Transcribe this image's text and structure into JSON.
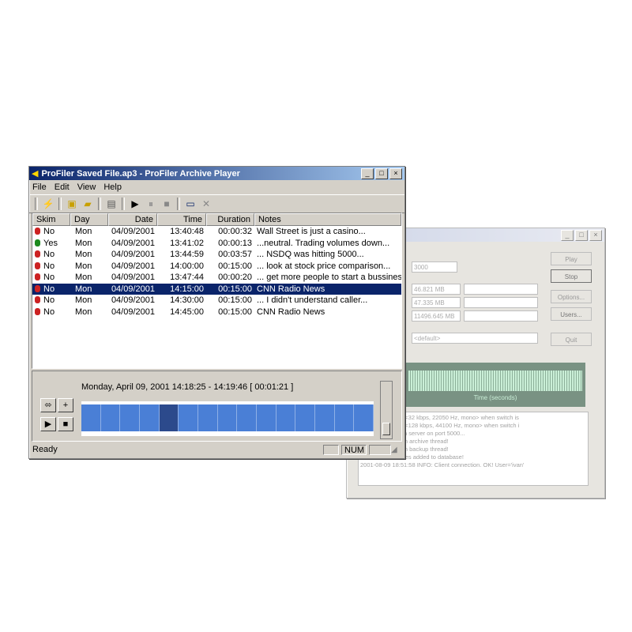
{
  "front_window": {
    "title": "ProFiler Saved File.ap3 - ProFiler Archive Player",
    "menu": [
      "File",
      "Edit",
      "View",
      "Help"
    ],
    "columns": [
      "Skim",
      "Day",
      "Date",
      "Time",
      "Duration",
      "Notes"
    ],
    "rows": [
      {
        "skim": "No",
        "mic_color": "#cc2222",
        "day": "Mon",
        "date": "04/09/2001",
        "time": "13:40:48",
        "duration": "00:00:32",
        "notes": "Wall Street is just a casino..."
      },
      {
        "skim": "Yes",
        "mic_color": "#1e8a1e",
        "day": "Mon",
        "date": "04/09/2001",
        "time": "13:41:02",
        "duration": "00:00:13",
        "notes": "...neutral.  Trading volumes down..."
      },
      {
        "skim": "No",
        "mic_color": "#cc2222",
        "day": "Mon",
        "date": "04/09/2001",
        "time": "13:44:59",
        "duration": "00:03:57",
        "notes": "... NSDQ was hitting 5000..."
      },
      {
        "skim": "No",
        "mic_color": "#cc2222",
        "day": "Mon",
        "date": "04/09/2001",
        "time": "14:00:00",
        "duration": "00:15:00",
        "notes": "... look at stock price comparison..."
      },
      {
        "skim": "No",
        "mic_color": "#cc2222",
        "day": "Mon",
        "date": "04/09/2001",
        "time": "13:47:44",
        "duration": "00:00:20",
        "notes": "... get more people to start a bussiness"
      },
      {
        "skim": "No",
        "mic_color": "#cc2222",
        "day": "Mon",
        "date": "04/09/2001",
        "time": "14:15:00",
        "duration": "00:15:00",
        "notes": "CNN Radio News",
        "selected": true
      },
      {
        "skim": "No",
        "mic_color": "#cc2222",
        "day": "Mon",
        "date": "04/09/2001",
        "time": "14:30:00",
        "duration": "00:15:00",
        "notes": "... I didn't understand caller..."
      },
      {
        "skim": "No",
        "mic_color": "#cc2222",
        "day": "Mon",
        "date": "04/09/2001",
        "time": "14:45:00",
        "duration": "00:15:00",
        "notes": "CNN Radio News"
      }
    ],
    "timeline_label": "Monday, April 09, 2001 14:18:25 - 14:19:46 [ 00:01:21 ]",
    "status_text": "Ready",
    "status_num": "NUM"
  },
  "back_window": {
    "title": "- <default>",
    "buttons": [
      "Play",
      "Stop",
      "Options...",
      "Users...",
      "Quit"
    ],
    "fields": [
      "3000",
      "46.821 MB",
      "47.335 MB",
      "11496.645 MB",
      "<default>"
    ],
    "waveform_caption": "Time (seconds)",
    "log_lines": [
      "9:02: INFO: Use <32 kbps, 22050 Hz, mono> when switch is",
      "9:02: INFO: Use <128 kbps, 44100 Hz, mono> when switch i",
      "9:02: INFO: Open server on port 5000...",
      "9:02: INFO: Begin archive thread!",
      "9:02: INFO: Begin backup thread!",
      "9:03: INFO: 15 files added to database!",
      "2001-08-09 18:51:58 INFO: Client connection. OK! User='ivan'"
    ]
  }
}
